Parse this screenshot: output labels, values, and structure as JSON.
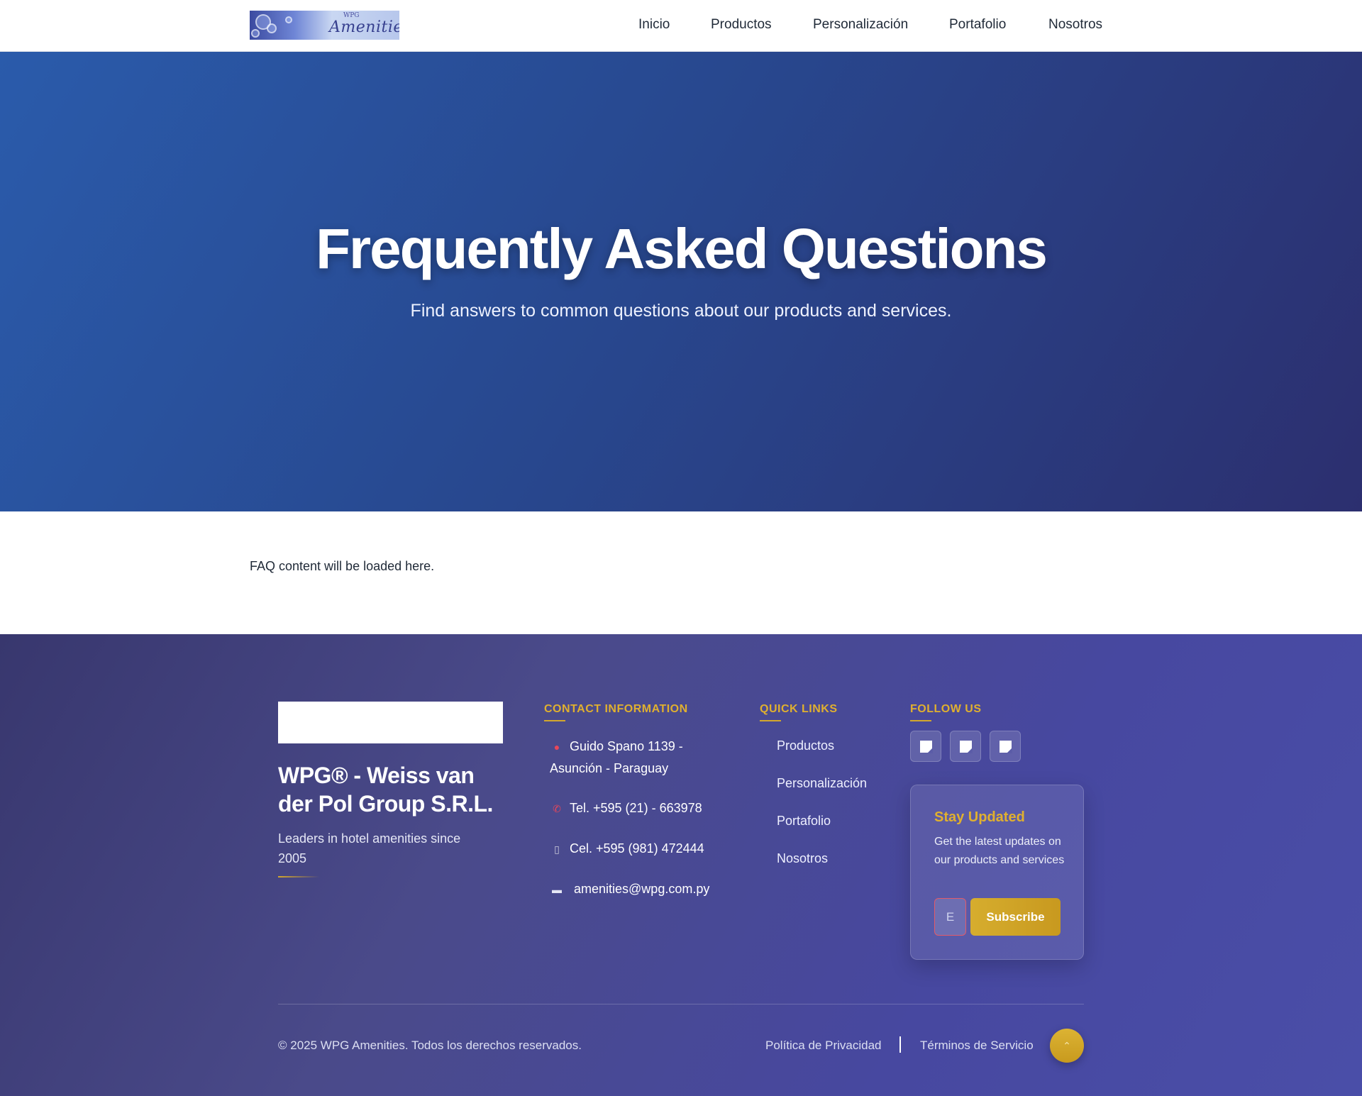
{
  "header": {
    "logo": {
      "small_text": "WPG",
      "text": "Amenities"
    },
    "nav": [
      "Inicio",
      "Productos",
      "Personalización",
      "Portafolio",
      "Nosotros"
    ]
  },
  "hero": {
    "title": "Frequently Asked Questions",
    "subtitle": "Find answers to common questions about our products and services."
  },
  "content": {
    "placeholder": "FAQ content will be loaded here."
  },
  "footer": {
    "company_name": "WPG® - Weiss van der Pol Group S.R.L.",
    "tagline": "Leaders in hotel amenities since 2005",
    "contact": {
      "heading": "CONTACT INFORMATION",
      "address": "Guido Spano 1139 - Asunción - Paraguay",
      "phone": "Tel. +595 (21) - 663978",
      "mobile": "Cel. +595 (981) 472444",
      "email": "amenities@wpg.com.py"
    },
    "quick_links": {
      "heading": "QUICK LINKS",
      "items": [
        "Productos",
        "Personalización",
        "Portafolio",
        "Nosotros"
      ]
    },
    "follow": {
      "heading": "FOLLOW US",
      "icons": [
        "social-icon",
        "social-icon",
        "social-icon"
      ]
    },
    "newsletter": {
      "title": "Stay Updated",
      "description": "Get the latest updates on our products and services",
      "input_placeholder": "E",
      "button": "Subscribe"
    },
    "copyright": "© 2025 WPG Amenities. Todos los derechos reservados.",
    "legal": [
      "Política de Privacidad",
      "Términos de Servicio"
    ],
    "back_to_top_icon": "chevron-up-icon"
  },
  "colors": {
    "accent_gold": "#d4a72c",
    "hero_start": "#2a5bab",
    "hero_end": "#2c2f6f",
    "footer_bg": "#4748a0"
  }
}
